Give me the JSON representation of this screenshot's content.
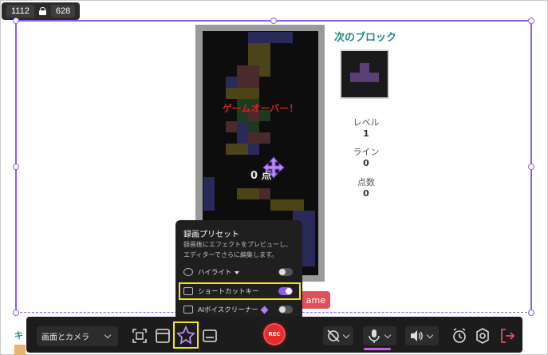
{
  "size_chip": {
    "width": "1112",
    "height": "628"
  },
  "game": {
    "game_over": "ゲームオーバー！",
    "score": "0 点",
    "next_title": "次のブロック",
    "level_label": "レベル",
    "level_value": "1",
    "lines_label": "ライン",
    "lines_value": "0",
    "points_label": "点数",
    "points_value": "0",
    "new_game": "ame",
    "peek_text": "キ"
  },
  "popup": {
    "title": "録画プリセット",
    "description": "録画後にエフェクトをプレビューし、エディターでさらに編集します。",
    "items": [
      {
        "label": "ハイライト",
        "on": false
      },
      {
        "label": "ショートカットキー",
        "on": true
      },
      {
        "label": "AIボイスクリーナー",
        "on": false
      }
    ]
  },
  "toolbar": {
    "mode": "画面とカメラ",
    "rec_label": "REC"
  },
  "colors": {
    "accent": "#8a5cf6",
    "highlight": "#f5e51a",
    "rec": "#e52b2b",
    "teal": "#1d8a86"
  }
}
